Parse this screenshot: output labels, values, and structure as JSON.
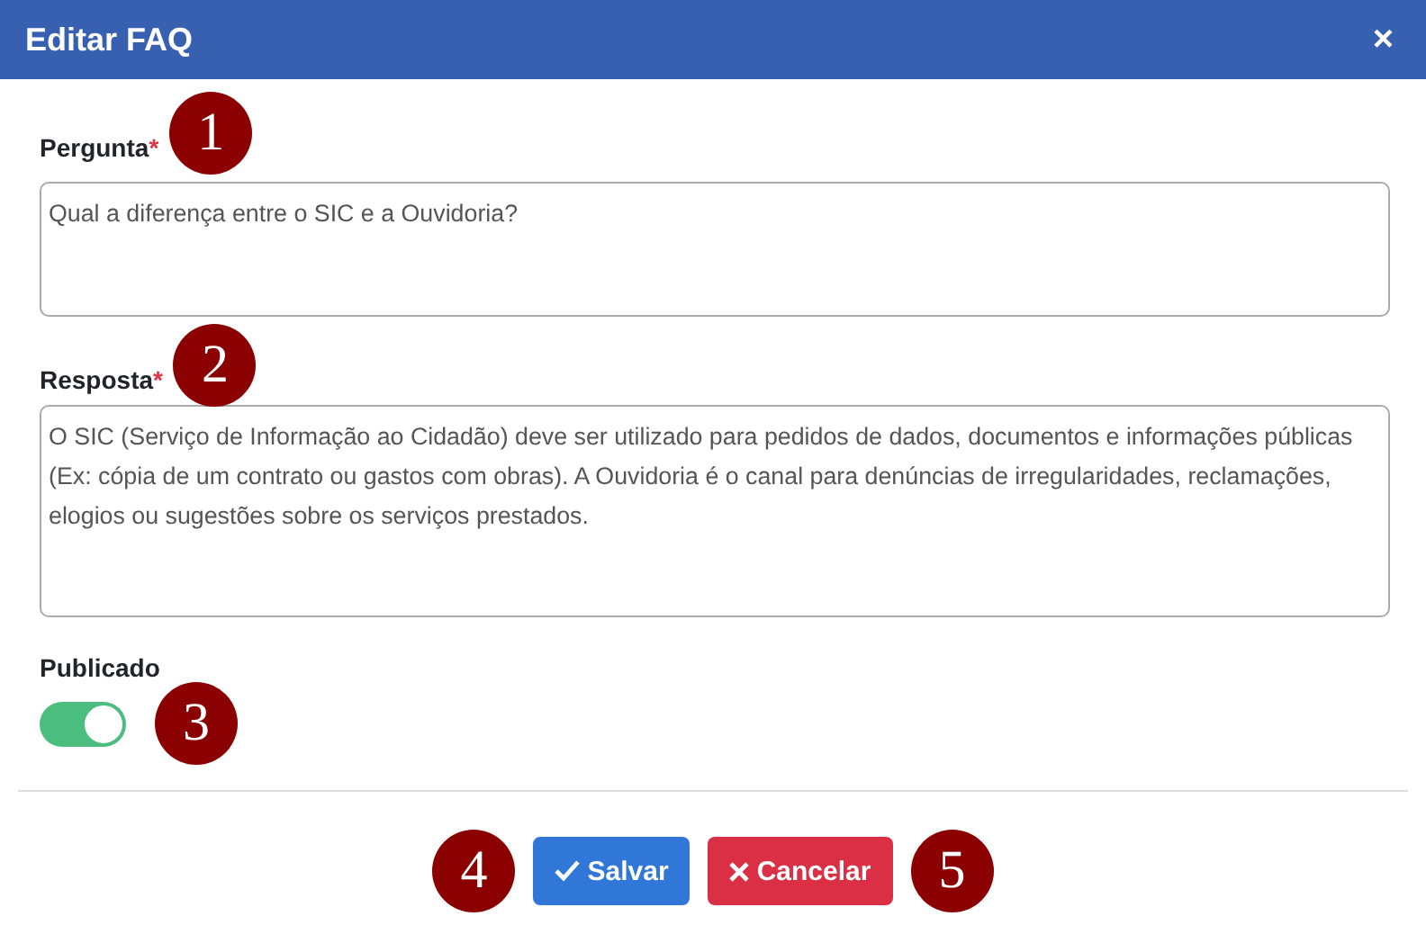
{
  "dialog": {
    "title": "Editar FAQ",
    "close": "×"
  },
  "fields": [
    {
      "label": "Pergunta",
      "required_mark": "*",
      "callout": "1",
      "value": "Qual a diferença entre o SIC e a Ouvidoria?",
      "kind": "short"
    },
    {
      "label": "Resposta",
      "required_mark": "*",
      "callout": "2",
      "value": "O SIC (Serviço de Informação ao Cidadão) deve ser utilizado para pedidos de dados, documentos e informações públicas (Ex: cópia de um contrato ou gastos com obras). A Ouvidoria é o canal para denúncias de irregularidades, reclamações, elogios ou sugestões sobre os serviços prestados.",
      "kind": "long"
    }
  ],
  "published": {
    "label": "Publicado",
    "on": true,
    "callout": "3"
  },
  "buttons": [
    {
      "label": "Salvar",
      "kind": "save",
      "callout": "4"
    },
    {
      "label": "Cancelar",
      "kind": "cancel",
      "callout": "5"
    }
  ]
}
